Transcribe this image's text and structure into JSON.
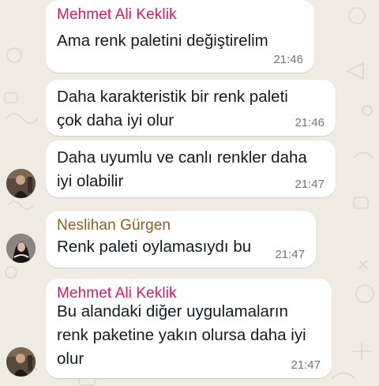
{
  "theme": {
    "wallpaper": "#efeae2",
    "bubble": "#ffffff",
    "sender_mehmet_color": "#d81b60",
    "sender_neslihan_color": "#8d5e1e",
    "text_color": "#111b21",
    "time_color": "#667781"
  },
  "messages": [
    {
      "sender": "Mehmet Ali Keklik",
      "lines": [
        "Ama renk paletini değiştirelim"
      ],
      "time": "21:46"
    },
    {
      "sender": "",
      "lines": [
        "Daha karakteristik bir renk paleti",
        "çok daha iyi olur"
      ],
      "time": "21:46"
    },
    {
      "sender": "",
      "lines": [
        "Daha uyumlu ve canlı renkler daha",
        "iyi olabilir"
      ],
      "time": "21:47",
      "avatar": "man-avatar-icon"
    },
    {
      "sender": "Neslihan Gürgen",
      "lines": [
        "Renk paleti oylamasıydı bu"
      ],
      "time": "21:47",
      "avatar": "woman-avatar-icon"
    },
    {
      "sender": "Mehmet Ali Keklik",
      "lines": [
        "Bu alandaki diğer uygulamaların",
        "renk paketine yakın olursa daha iyi",
        "olur"
      ],
      "time": "21:47",
      "avatar": "man-avatar-icon"
    }
  ]
}
